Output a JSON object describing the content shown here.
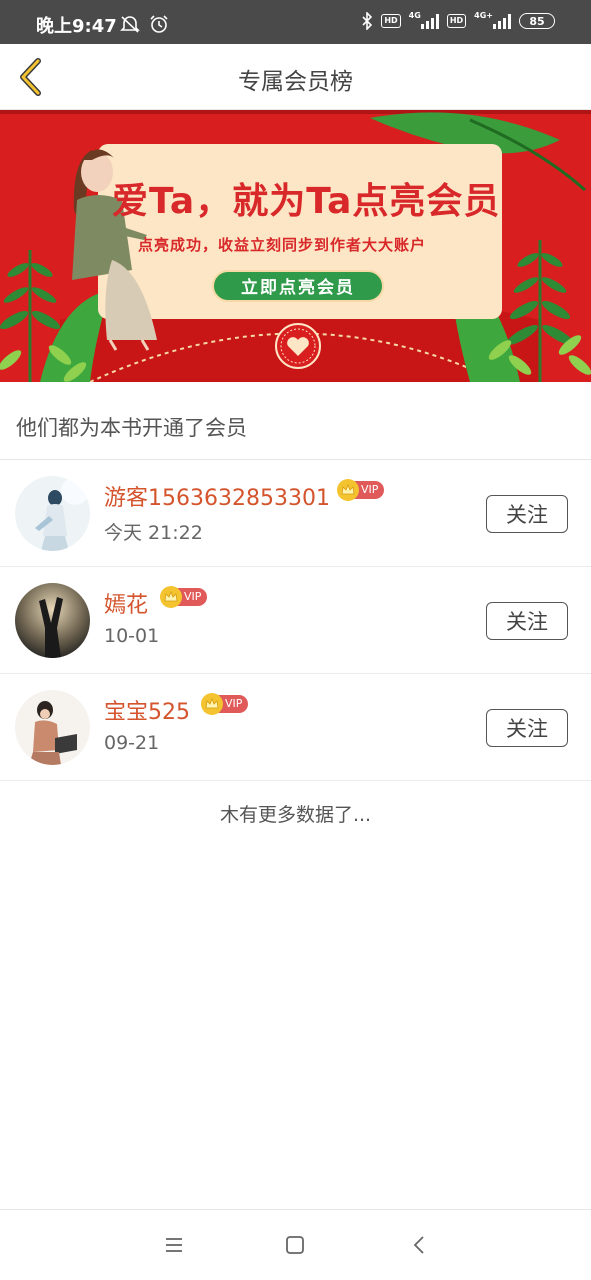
{
  "status_bar": {
    "time": "晚上9:47",
    "left_icons": [
      "alarm-off-icon",
      "alarm-clock-icon"
    ],
    "right_icons": [
      "bluetooth-icon",
      "hd-icon",
      "signal-4g-icon",
      "hd-icon",
      "signal-4g-plus-icon"
    ],
    "net1": "4G",
    "net2": "4G+",
    "hd": "HD",
    "battery": "85"
  },
  "header": {
    "title": "专属会员榜",
    "back_icon": "chevron-left-icon",
    "back_color": "#f2c230"
  },
  "banner": {
    "headline": "爱Ta，就为Ta点亮会员",
    "subline": "点亮成功，收益立刻同步到作者大大账户",
    "button_label": "立即点亮会员",
    "colors": {
      "background": "#d81e1e",
      "card": "#fde6c5",
      "button": "#2f9a4a",
      "text": "#d8282a"
    }
  },
  "section": {
    "title": "他们都为本书开通了会员"
  },
  "members": [
    {
      "name": "游客1563632853301",
      "vip": "VIP",
      "time": "今天 21:22",
      "follow": "关注"
    },
    {
      "name": "嫣花",
      "vip": "VIP",
      "time": "10-01",
      "follow": "关注"
    },
    {
      "name": "宝宝525",
      "vip": "VIP",
      "time": "09-21",
      "follow": "关注"
    }
  ],
  "footer_text": "木有更多数据了...",
  "nav": {
    "items": [
      "menu-icon",
      "home-icon",
      "back-icon"
    ]
  },
  "accent_colors": {
    "name": "#d4542e",
    "vip_tag": "#e05a5a",
    "crown": "#f4c430"
  }
}
